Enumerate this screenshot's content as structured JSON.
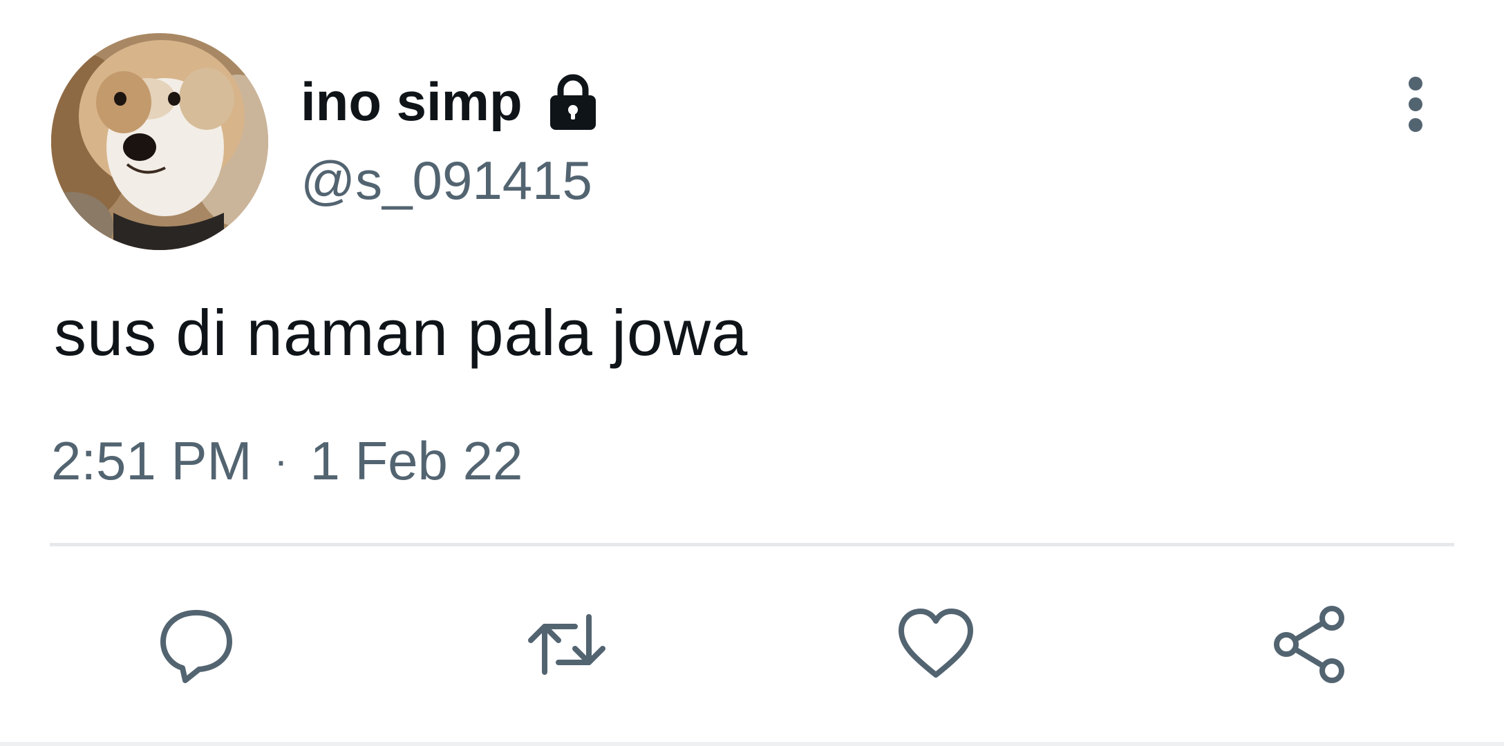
{
  "tweet": {
    "display_name": "ino simp",
    "handle": "@s_091415",
    "text": "sus di naman pala jowa",
    "time": "2:51 PM",
    "separator": "·",
    "date": "1 Feb 22"
  },
  "icons": {
    "lock": "lock-icon",
    "more": "more-vertical-icon",
    "reply": "reply-icon",
    "retweet": "retweet-icon",
    "like": "heart-icon",
    "share": "share-icon"
  },
  "colors": {
    "primary_text": "#0f1419",
    "secondary_text": "#536471",
    "divider": "#e6e9eb",
    "background": "#ffffff"
  }
}
